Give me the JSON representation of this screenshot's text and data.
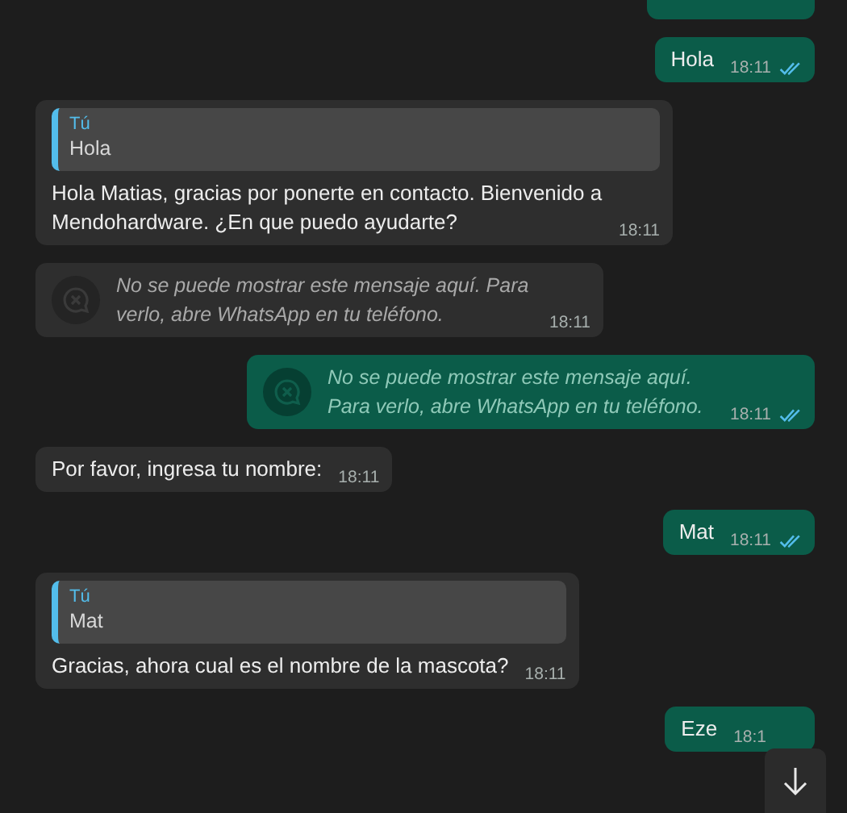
{
  "messages": [
    {
      "outgoing": true,
      "kind": "cut_off"
    },
    {
      "outgoing": true,
      "kind": "text",
      "text": "Hola",
      "time": "18:11",
      "read": true
    },
    {
      "outgoing": false,
      "kind": "quoted",
      "quote_author": "Tú",
      "quote_text": "Hola",
      "text": "Hola Matias, gracias por ponerte en contacto. Bienvenido a Mendohardware. ¿En que puedo ayudarte?",
      "time": "18:11"
    },
    {
      "outgoing": false,
      "kind": "unsupported",
      "text": "No se puede mostrar este mensaje aquí. Para verlo, abre WhatsApp en tu teléfono.",
      "time": "18:11"
    },
    {
      "outgoing": true,
      "kind": "unsupported",
      "text": "No se puede mostrar este mensaje aquí. Para verlo, abre WhatsApp en tu teléfono.",
      "time": "18:11",
      "read": true
    },
    {
      "outgoing": false,
      "kind": "text",
      "text": "Por favor, ingresa tu nombre:",
      "time": "18:11"
    },
    {
      "outgoing": true,
      "kind": "text",
      "text": "Mat",
      "time": "18:11",
      "read": true
    },
    {
      "outgoing": false,
      "kind": "quoted",
      "quote_author": "Tú",
      "quote_text": "Mat",
      "text": "Gracias, ahora cual es el nombre de la mascota?",
      "time": "18:11"
    },
    {
      "outgoing": true,
      "kind": "text",
      "text": "Eze",
      "time": "18:1"
    }
  ],
  "scroll_button": {
    "visible": true
  }
}
